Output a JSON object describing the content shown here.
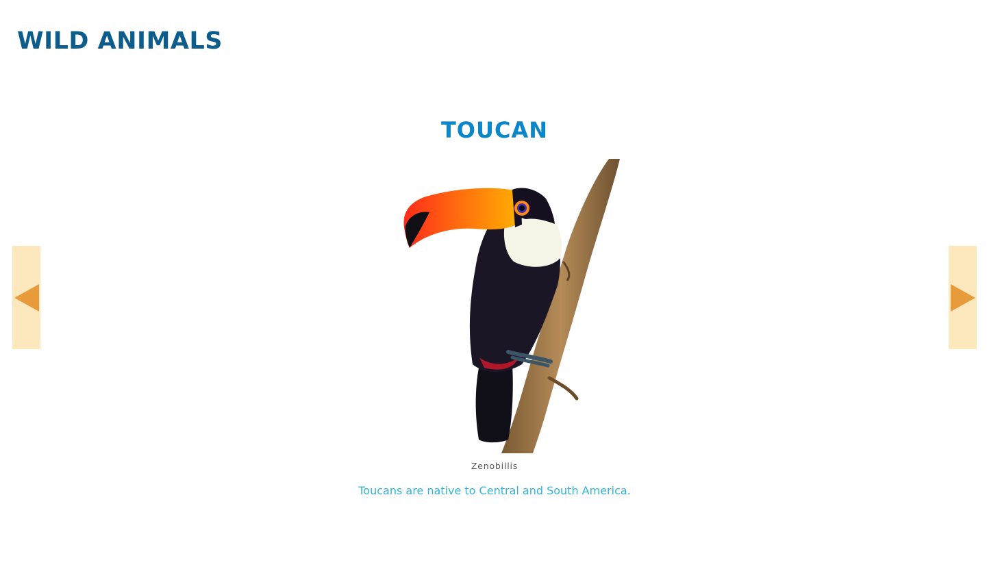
{
  "header": {
    "site_title": "WILD ANIMALS"
  },
  "slide": {
    "title": "TOUCAN",
    "image_alt": "Toucan perched on a branch",
    "photo_credit": "Zenobillis",
    "fact": "Toucans are native to Central and South America."
  },
  "navigation": {
    "prev_icon": "triangle-left-icon",
    "next_icon": "triangle-right-icon"
  },
  "colors": {
    "site_title": "#0d5d8c",
    "animal_title": "#0a86c9",
    "fact_text": "#33b3d6",
    "nav_background": "#fde7bd",
    "nav_arrow": "#e89b3a"
  }
}
